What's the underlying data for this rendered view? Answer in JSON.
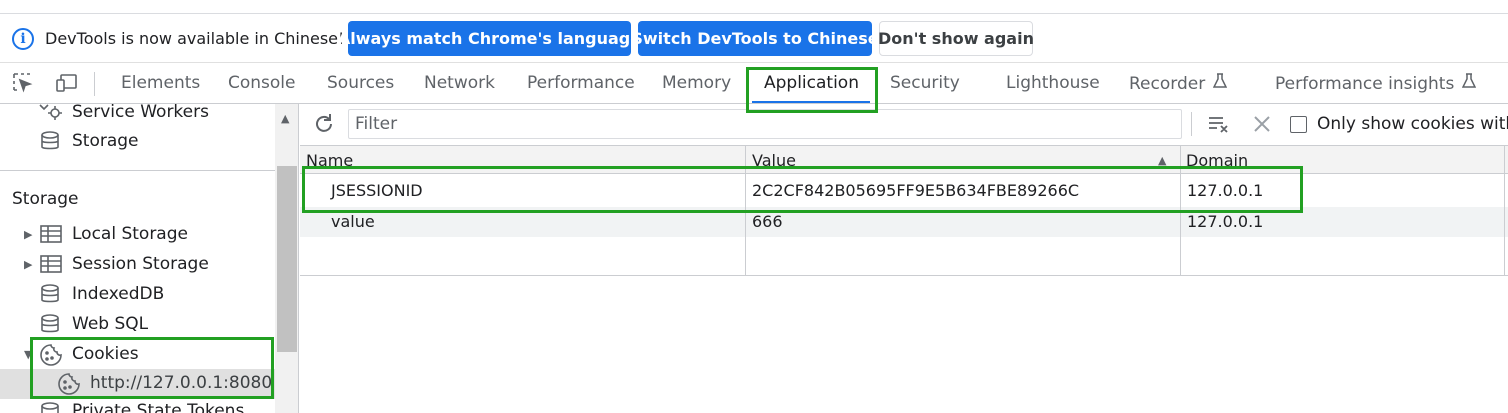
{
  "infobar": {
    "message": "DevTools is now available in Chinese!",
    "btn_match": "Always match Chrome's language",
    "btn_switch": "Switch DevTools to Chinese",
    "btn_dismiss": "Don't show again"
  },
  "tabs": [
    {
      "label": "Elements"
    },
    {
      "label": "Console"
    },
    {
      "label": "Sources"
    },
    {
      "label": "Network"
    },
    {
      "label": "Performance"
    },
    {
      "label": "Memory"
    },
    {
      "label": "Application"
    },
    {
      "label": "Security"
    },
    {
      "label": "Lighthouse"
    },
    {
      "label": "Recorder"
    },
    {
      "label": "Performance insights"
    }
  ],
  "sidebar": {
    "service_workers": "Service Workers",
    "storage_item": "Storage",
    "storage_section": "Storage",
    "local_storage": "Local Storage",
    "session_storage": "Session Storage",
    "indexeddb": "IndexedDB",
    "web_sql": "Web SQL",
    "cookies": "Cookies",
    "cookie_origin": "http://127.0.0.1:8080",
    "private_state_tokens": "Private State Tokens"
  },
  "toolbar": {
    "filter_placeholder": "Filter",
    "filter_value": "",
    "only_show_label": "Only show cookies with"
  },
  "table": {
    "headers": {
      "name": "Name",
      "value": "Value",
      "domain": "Domain"
    },
    "rows": [
      {
        "name": "JSESSIONID",
        "value": "2C2CF842B05695FF9E5B634FBE89266C",
        "domain": "127.0.0.1"
      },
      {
        "name": "value",
        "value": "666",
        "domain": "127.0.0.1"
      }
    ]
  },
  "colors": {
    "accent": "#1a73e8",
    "highlight": "#22a022"
  }
}
